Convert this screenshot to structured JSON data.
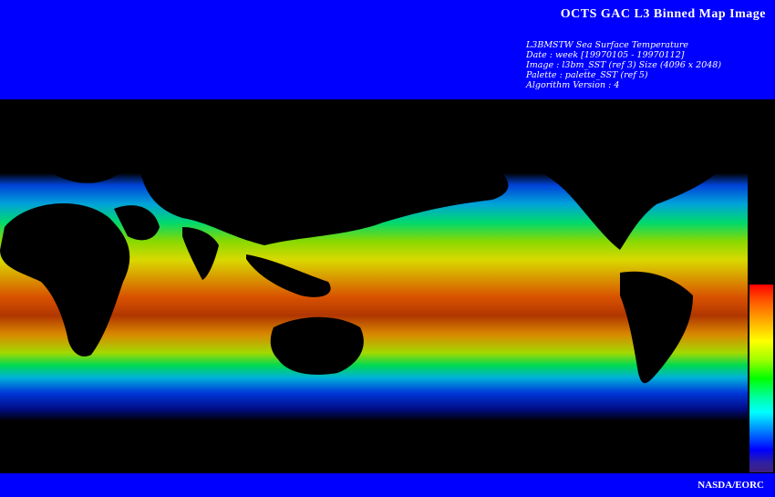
{
  "header": {
    "title": "OCTS GAC L3 Binned Map Image",
    "meta": [
      "L3BMSTW Sea Surface Temperature",
      "Date : week [19970105 - 19970112]",
      "Image : l3bm_SST (ref 3) Size (4096 x 2048)",
      "Palette : palette_SST (ref 5)",
      "Algorithm Version : 4"
    ]
  },
  "footer": {
    "credit": "NASDA/EORC"
  },
  "colors": {
    "banner": "#0000ff",
    "background": "#000000",
    "text": "#ffffff",
    "palette_top": "#ff0000",
    "palette_bottom": "#402080"
  },
  "colorbar": {
    "orientation": "vertical",
    "gradient": [
      "red",
      "orange",
      "yellow",
      "green",
      "cyan",
      "blue",
      "purple"
    ]
  }
}
